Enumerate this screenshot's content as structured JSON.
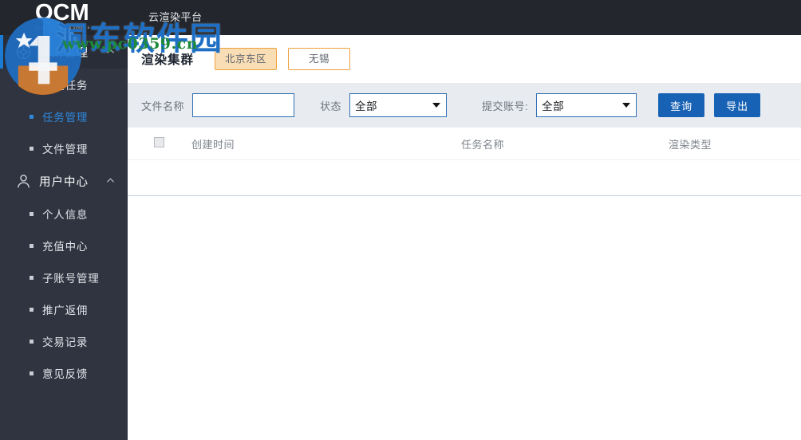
{
  "topbar": {
    "logo_text": "QCM",
    "logo_subtitle": "Make IT Rendering Simple & Clear & Rapid",
    "platform_title": "云渲染平台",
    "background_color": "#23272d"
  },
  "sidebar": {
    "background_color": "#2f3440",
    "accent_color": "#1a7ad4",
    "groups": [
      {
        "label": "渲染管理",
        "icon": "render-target-icon",
        "chevron": "chevron-up-icon",
        "expanded": true,
        "items": [
          {
            "label": "新建任务",
            "active": false
          },
          {
            "label": "任务管理",
            "active": true
          },
          {
            "label": "文件管理",
            "active": false
          }
        ]
      },
      {
        "label": "用户中心",
        "icon": "user-icon",
        "chevron": "chevron-up-icon",
        "expanded": true,
        "items": [
          {
            "label": "个人信息",
            "active": false
          },
          {
            "label": "充值中心",
            "active": false
          },
          {
            "label": "子账号管理",
            "active": false
          },
          {
            "label": "推广返佣",
            "active": false
          },
          {
            "label": "交易记录",
            "active": false
          },
          {
            "label": "意见反馈",
            "active": false
          }
        ]
      }
    ]
  },
  "page": {
    "title": "渲染集群",
    "cluster_tabs": [
      {
        "label": "北京东区",
        "active": true
      },
      {
        "label": "无锡",
        "active": false
      }
    ],
    "tab_border_color": "#efa03c",
    "tab_active_fill": "#f9ddb5"
  },
  "filters": {
    "background_color": "#e8ecf1",
    "filename": {
      "label": "文件名称",
      "value": "",
      "placeholder": ""
    },
    "status": {
      "label": "状态",
      "selected": "全部",
      "options": [
        "全部"
      ]
    },
    "account": {
      "label": "提交账号:",
      "selected": "全部",
      "options": [
        "全部"
      ]
    },
    "buttons": [
      {
        "label": "查询",
        "name": "query-button"
      },
      {
        "label": "导出",
        "name": "export-button"
      }
    ],
    "button_color": "#1862b5"
  },
  "table": {
    "select_all_checked": false,
    "columns": [
      "创建时间",
      "任务名称",
      "渲染类型"
    ],
    "rows": []
  },
  "watermark": {
    "text_cn": "洞东软件园",
    "text_url": "www.pc0359.cn",
    "color_cn": "#1f6fc4",
    "color_url": "#1d8a39"
  }
}
